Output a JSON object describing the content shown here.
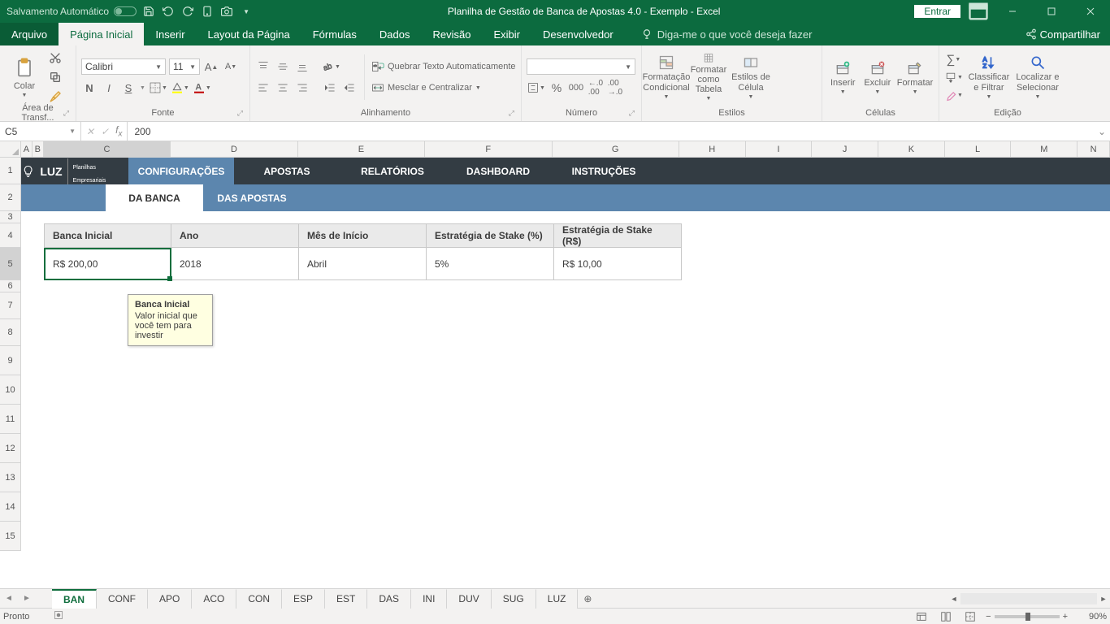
{
  "titlebar": {
    "autosave_label": "Salvamento Automático",
    "title": "Planilha de Gestão de Banca de Apostas 4.0 - Exemplo  -  Excel",
    "entrar": "Entrar"
  },
  "menu": {
    "file": "Arquivo",
    "tabs": [
      "Página Inicial",
      "Inserir",
      "Layout da Página",
      "Fórmulas",
      "Dados",
      "Revisão",
      "Exibir",
      "Desenvolvedor"
    ],
    "active_index": 0,
    "tellme": "Diga-me o que você deseja fazer",
    "share": "Compartilhar"
  },
  "ribbon": {
    "clipboard": {
      "label": "Área de Transf...",
      "paste": "Colar"
    },
    "font": {
      "label": "Fonte",
      "name": "Calibri",
      "size": "11",
      "bold": "N",
      "italic": "I",
      "underline": "S"
    },
    "alignment": {
      "label": "Alinhamento",
      "wrap": "Quebrar Texto Automaticamente",
      "merge": "Mesclar e Centralizar"
    },
    "number": {
      "label": "Número"
    },
    "styles": {
      "label": "Estilos",
      "cond": "Formatação Condicional",
      "table": "Formatar como Tabela",
      "cell": "Estilos de Célula"
    },
    "cells": {
      "label": "Células",
      "insert": "Inserir",
      "delete": "Excluir",
      "format": "Formatar"
    },
    "editing": {
      "label": "Edição",
      "sort": "Classificar e Filtrar",
      "find": "Localizar e Selecionar"
    }
  },
  "formula_bar": {
    "name": "C5",
    "value": "200"
  },
  "columns": [
    "A",
    "B",
    "C",
    "D",
    "E",
    "F",
    "G",
    "H",
    "I",
    "J",
    "K",
    "L",
    "M",
    "N"
  ],
  "active_col_index": 2,
  "rows": [
    1,
    2,
    3,
    4,
    5,
    6,
    7,
    8,
    9,
    10,
    11,
    12,
    13,
    14,
    15
  ],
  "active_row_index": 4,
  "sheet_nav": {
    "brand": "LUZ",
    "brand_sub": "Planilhas Empresariais",
    "tabs": [
      "CONFIGURAÇÕES",
      "APOSTAS",
      "RELATÓRIOS",
      "DASHBOARD",
      "INSTRUÇÕES"
    ],
    "active": 0
  },
  "sub_nav": {
    "tabs": [
      "DA BANCA",
      "DAS APOSTAS"
    ],
    "active": 0
  },
  "config_table": {
    "headers": [
      "Banca Inicial",
      "Ano",
      "Mês de Início",
      "Estratégia de Stake (%)",
      "Estratégia de Stake (R$)"
    ],
    "values": [
      "R$ 200,00",
      "2018",
      "Abril",
      "5%",
      "R$ 10,00"
    ]
  },
  "tooltip": {
    "title": "Banca Inicial",
    "body": "Valor inicial que você tem para investir"
  },
  "sheet_tabs": [
    "BAN",
    "CONF",
    "APO",
    "ACO",
    "CON",
    "ESP",
    "EST",
    "DAS",
    "INI",
    "DUV",
    "SUG",
    "LUZ"
  ],
  "active_sheet": 0,
  "status": {
    "ready": "Pronto",
    "zoom": "90%"
  }
}
